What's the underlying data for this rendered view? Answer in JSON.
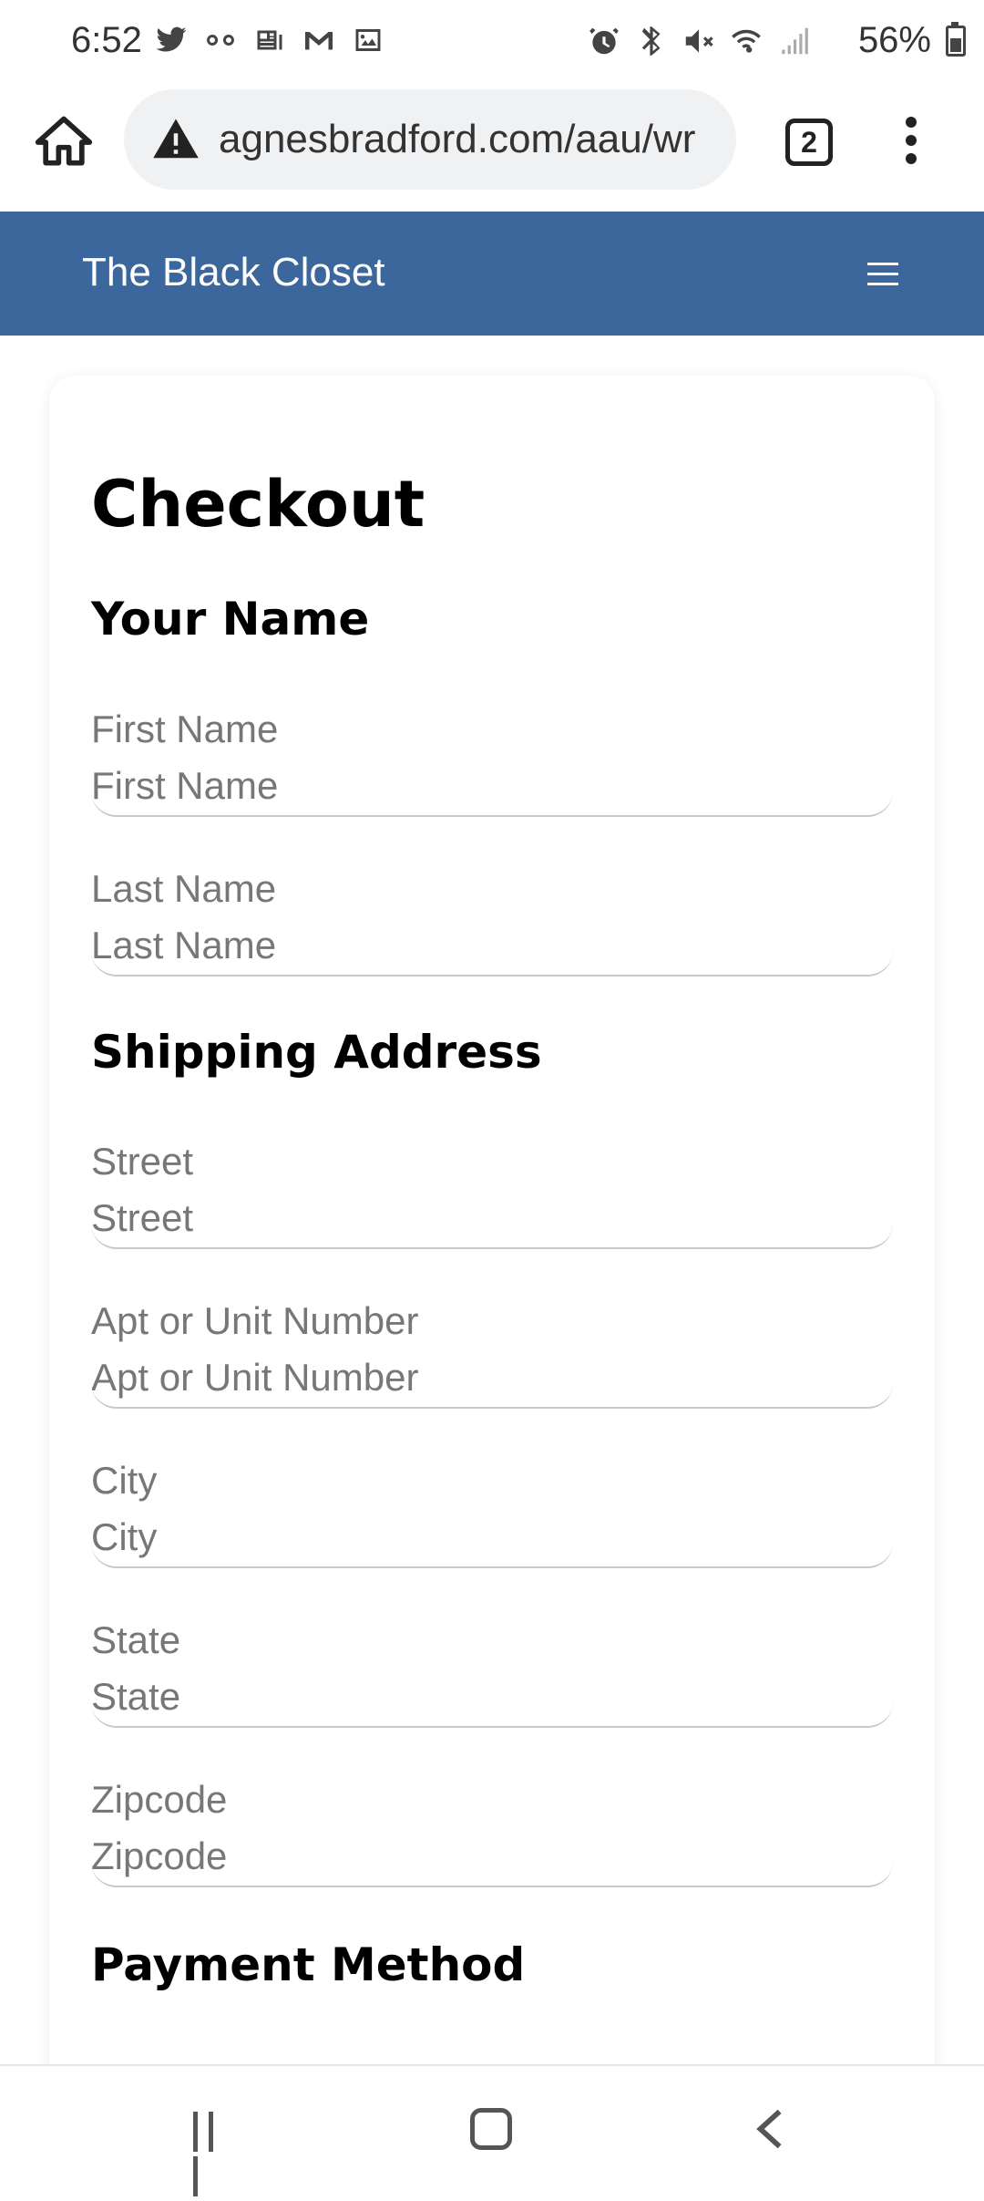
{
  "status_bar": {
    "time": "6:52",
    "battery": "56%",
    "icons_left": [
      "twitter-icon",
      "voicemail-icon",
      "news-icon",
      "gmail-icon",
      "image-icon"
    ],
    "icons_right": [
      "alarm-icon",
      "bluetooth-icon",
      "mute-icon",
      "wifi-icon",
      "signal-icon"
    ]
  },
  "browser": {
    "url": "agnesbradford.com/aau/wr",
    "tab_count": "2"
  },
  "site": {
    "title": "The Black Closet"
  },
  "page": {
    "title": "Checkout",
    "sections": {
      "name": "Your Name",
      "shipping": "Shipping Address",
      "payment": "Payment Method"
    },
    "fields": {
      "first_name": {
        "label": "First Name",
        "placeholder": "First Name"
      },
      "last_name": {
        "label": "Last Name",
        "placeholder": "Last Name"
      },
      "street": {
        "label": "Street",
        "placeholder": "Street"
      },
      "apt": {
        "label": "Apt or Unit Number",
        "placeholder": "Apt or Unit Number"
      },
      "city": {
        "label": "City",
        "placeholder": "City"
      },
      "state": {
        "label": "State",
        "placeholder": "State"
      },
      "zipcode": {
        "label": "Zipcode",
        "placeholder": "Zipcode"
      }
    }
  }
}
